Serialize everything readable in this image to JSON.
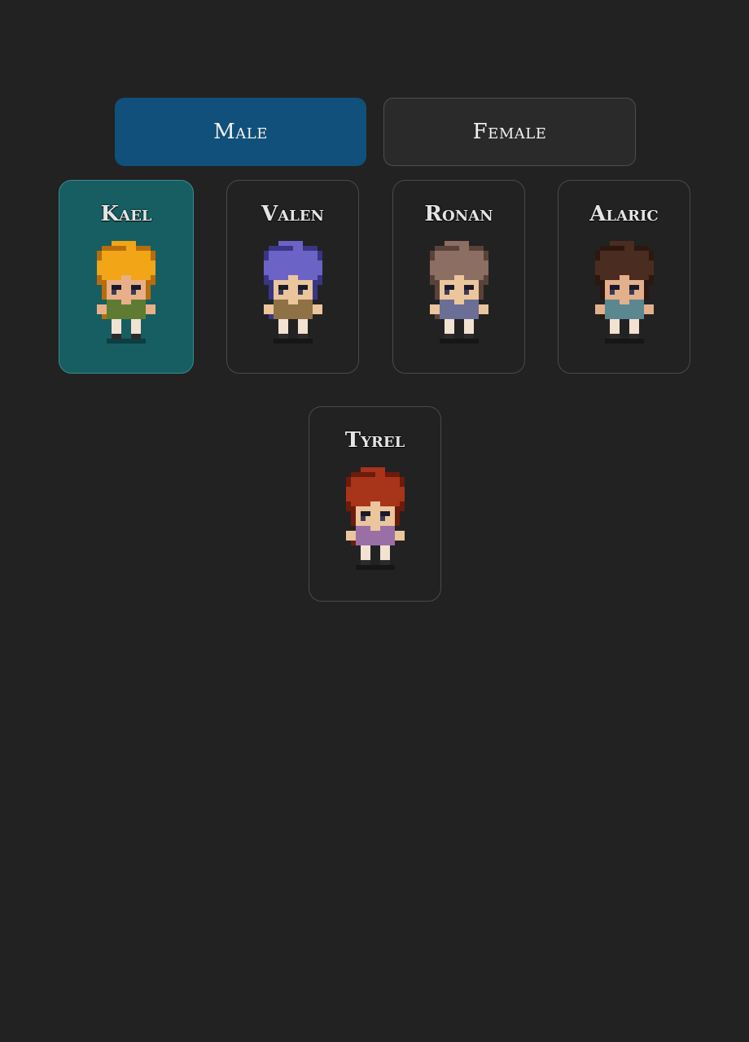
{
  "gender_tabs": [
    {
      "label": "Male",
      "selected": true
    },
    {
      "label": "Female",
      "selected": false
    }
  ],
  "characters": [
    {
      "name": "Kael",
      "selected": true,
      "hair": "#f2a516",
      "hair_dark": "#b86d0c",
      "shirt": "#5f7b33",
      "skin": "#e8b088"
    },
    {
      "name": "Valen",
      "selected": false,
      "hair": "#6b64c6",
      "hair_dark": "#3b3585",
      "shirt": "#8f7146",
      "skin": "#ebc59c"
    },
    {
      "name": "Ronan",
      "selected": false,
      "hair": "#8c6e62",
      "hair_dark": "#5a4239",
      "shirt": "#6b6f96",
      "skin": "#ebc59c"
    },
    {
      "name": "Alaric",
      "selected": false,
      "hair": "#4a2c20",
      "hair_dark": "#2c1810",
      "shirt": "#5a8790",
      "skin": "#e3b08c"
    },
    {
      "name": "Tyrel",
      "selected": false,
      "hair": "#a8341a",
      "hair_dark": "#6c1c0c",
      "shirt": "#9a6fa6",
      "skin": "#ebc59c"
    }
  ]
}
